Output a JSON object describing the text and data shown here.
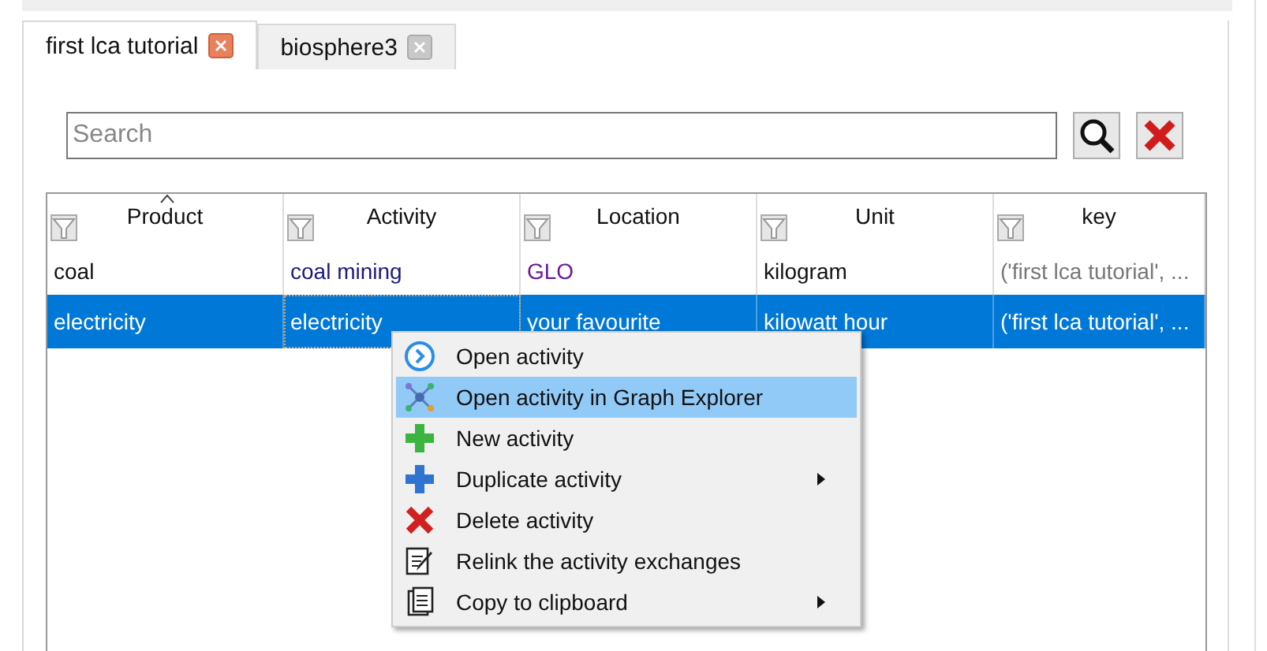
{
  "tabs": [
    {
      "label": "first lca tutorial",
      "selected": true
    },
    {
      "label": "biosphere3",
      "selected": false
    }
  ],
  "search": {
    "placeholder": "Search"
  },
  "table": {
    "columns": [
      {
        "label": "Product",
        "sorted": true
      },
      {
        "label": "Activity",
        "sorted": false
      },
      {
        "label": "Location",
        "sorted": false
      },
      {
        "label": "Unit",
        "sorted": false
      },
      {
        "label": "key",
        "sorted": false
      }
    ],
    "rows": [
      {
        "selected": false,
        "cells": [
          "coal",
          "coal mining",
          "GLO",
          "kilogram",
          "('first lca tutorial', ..."
        ]
      },
      {
        "selected": true,
        "cells": [
          "electricity",
          "electricity",
          "your favourite",
          "kilowatt hour",
          "('first lca tutorial', ..."
        ]
      }
    ]
  },
  "context_menu": {
    "items": [
      {
        "kind": "open",
        "label": "Open activity",
        "highlighted": false,
        "submenu": false
      },
      {
        "kind": "graph",
        "label": "Open activity in Graph Explorer",
        "highlighted": true,
        "submenu": false
      },
      {
        "kind": "new",
        "label": "New activity",
        "highlighted": false,
        "submenu": false
      },
      {
        "kind": "duplicate",
        "label": "Duplicate activity",
        "highlighted": false,
        "submenu": true
      },
      {
        "kind": "delete",
        "label": "Delete activity",
        "highlighted": false,
        "submenu": false
      },
      {
        "kind": "relink",
        "label": "Relink the activity exchanges",
        "highlighted": false,
        "submenu": false
      },
      {
        "kind": "copy",
        "label": "Copy to clipboard",
        "highlighted": false,
        "submenu": true
      }
    ]
  }
}
